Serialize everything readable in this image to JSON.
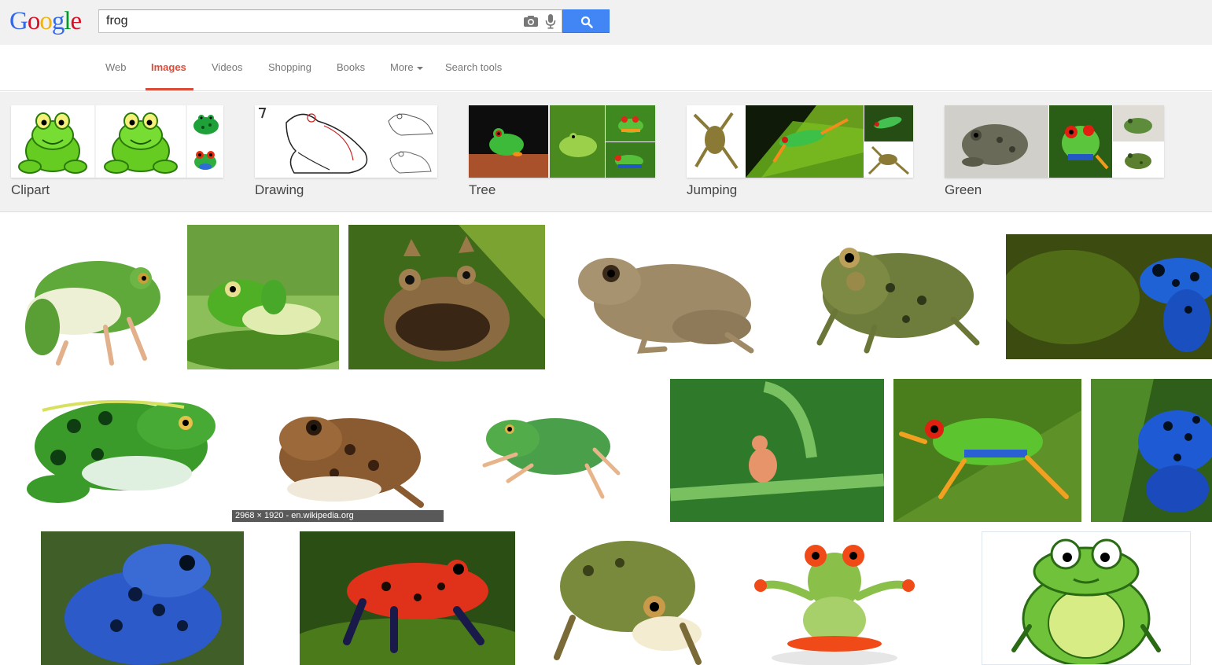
{
  "logo": {
    "letters": [
      "G",
      "o",
      "o",
      "g",
      "l",
      "e"
    ],
    "colors": [
      "#3369e8",
      "#d50f25",
      "#eeb211",
      "#3369e8",
      "#009925",
      "#d50f25"
    ]
  },
  "search": {
    "value": "frog"
  },
  "nav": {
    "tabs": [
      {
        "label": "Web"
      },
      {
        "label": "Images",
        "active": true
      },
      {
        "label": "Videos"
      },
      {
        "label": "Shopping"
      },
      {
        "label": "Books"
      },
      {
        "label": "More"
      },
      {
        "label": "Search tools"
      }
    ]
  },
  "related": [
    {
      "label": "Clipart"
    },
    {
      "label": "Drawing"
    },
    {
      "label": "Tree"
    },
    {
      "label": "Jumping"
    },
    {
      "label": "Green"
    }
  ],
  "results": {
    "hover_meta": "2968 × 1920 - en.wikipedia.org"
  },
  "colors": {
    "accent": "#dd4b39",
    "search_button": "#4285f4",
    "header_bg": "#f1f1f1"
  },
  "icons": [
    "camera-icon",
    "microphone-icon",
    "search-icon",
    "caret-down-icon"
  ]
}
